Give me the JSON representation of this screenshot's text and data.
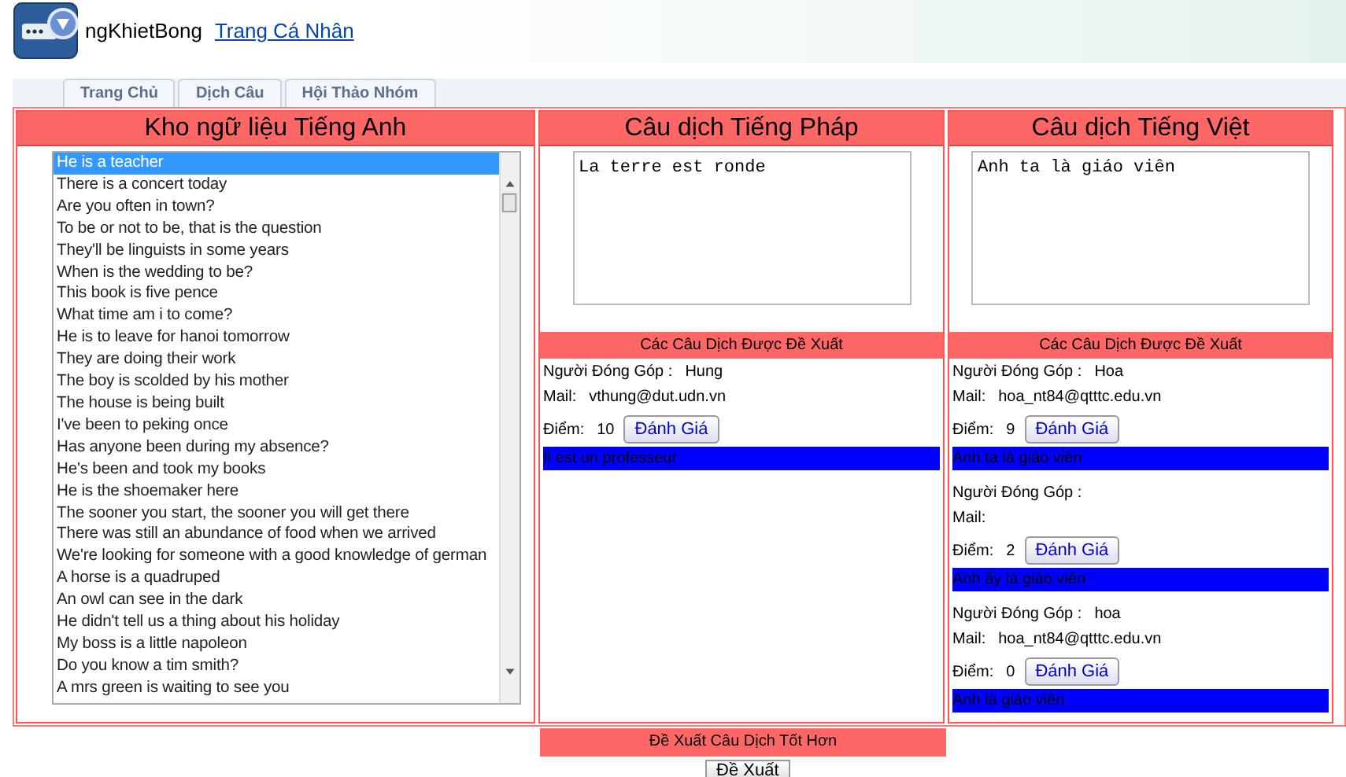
{
  "header": {
    "site_name": "ngKhietBong",
    "profile_link": "Trang Cá Nhân"
  },
  "tabs": [
    {
      "label": "Trang Chủ",
      "selected": false
    },
    {
      "label": "Dịch Câu",
      "selected": false
    },
    {
      "label": "Hội Thảo Nhóm",
      "selected": false
    }
  ],
  "english": {
    "title": "Kho ngữ liệu Tiếng Anh",
    "sentences": [
      {
        "text": "He is a teacher",
        "selected": true
      },
      {
        "text": "There is a concert today",
        "selected": false
      },
      {
        "text": "Are you often in town?",
        "selected": false
      },
      {
        "text": "To be or not to be, that is the question",
        "selected": false
      },
      {
        "text": "They'll be linguists in some years",
        "selected": false
      },
      {
        "text": "When is the wedding to be?",
        "selected": false
      },
      {
        "text": "This book is five pence",
        "selected": false
      },
      {
        "text": "What time am i to come?",
        "selected": false
      },
      {
        "text": "He is to leave for hanoi tomorrow",
        "selected": false
      },
      {
        "text": "They are doing their work",
        "selected": false
      },
      {
        "text": "The boy is scolded by his mother",
        "selected": false
      },
      {
        "text": "The house is being built",
        "selected": false
      },
      {
        "text": "I've been to peking once",
        "selected": false
      },
      {
        "text": "Has anyone been during my absence?",
        "selected": false
      },
      {
        "text": "He's been and took my books",
        "selected": false
      },
      {
        "text": "He is the shoemaker here",
        "selected": false
      },
      {
        "text": "The sooner you start, the sooner you will get there",
        "selected": false
      },
      {
        "text": "There was still an abundance of food when we arrived",
        "selected": false
      },
      {
        "text": "We're looking for someone with a good knowledge of german",
        "selected": false
      },
      {
        "text": "A horse is a quadruped",
        "selected": false
      },
      {
        "text": "An owl can see in the dark",
        "selected": false
      },
      {
        "text": "He didn't tell us a thing about his holiday",
        "selected": false
      },
      {
        "text": "My boss is a little napoleon",
        "selected": false
      },
      {
        "text": "Do you know a tim smith?",
        "selected": false
      },
      {
        "text": "A mrs green is waiting to see you",
        "selected": false
      }
    ]
  },
  "translations": [
    {
      "title": "Câu dịch Tiếng Pháp",
      "translation": "La terre est ronde",
      "suggestions_title": "Các Câu Dịch Được Đề Xuất",
      "suggestions": [
        {
          "contributor_label": "Người Đóng Góp :",
          "contributor": "Hung",
          "mail_label": "Mail:",
          "mail": "vthung@dut.udn.vn",
          "score_label": "Điểm:",
          "score": "10",
          "rate_button": "Đánh Giá",
          "text": "Il est un professeur"
        }
      ]
    },
    {
      "title": "Câu dịch Tiếng Việt",
      "translation": "Anh ta là giáo viên",
      "suggestions_title": "Các Câu Dịch Được Đề Xuất",
      "suggestions": [
        {
          "contributor_label": "Người Đóng Góp :",
          "contributor": "Hoa",
          "mail_label": "Mail:",
          "mail": "hoa_nt84@qtttc.edu.vn",
          "score_label": "Điểm:",
          "score": "9",
          "rate_button": "Đánh Giá",
          "text": "Anh ta là giáo viên"
        },
        {
          "contributor_label": "Người Đóng Góp :",
          "mail_label": "Mail:",
          "score_label": "Điểm:",
          "score": "2",
          "rate_button": "Đánh Giá",
          "text": "Anh ấy là giáo viên"
        },
        {
          "contributor_label": "Người Đóng Góp :",
          "contributor": "hoa",
          "mail_label": "Mail:",
          "mail": "hoa_nt84@qtttc.edu.vn",
          "score_label": "Điểm:",
          "score": "0",
          "rate_button": "Đánh Giá",
          "text": "Anh là giáo viên"
        }
      ]
    }
  ],
  "propose": {
    "title": "Đề Xuất Câu Dịch Tốt Hơn",
    "button": "Đề Xuất"
  }
}
